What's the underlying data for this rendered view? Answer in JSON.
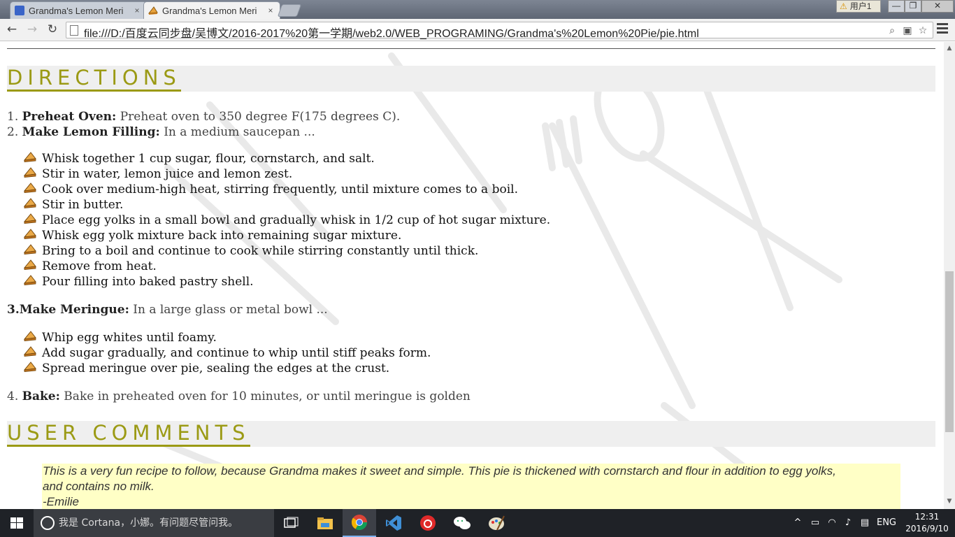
{
  "browser": {
    "tabs": [
      {
        "title": "Grandma's Lemon Meri",
        "close": "×"
      },
      {
        "title": "Grandma's Lemon Meri",
        "close": "×"
      }
    ],
    "user_badge": "用户1",
    "window_buttons": {
      "minimize": "—",
      "restore": "❐",
      "close": "✕"
    },
    "nav": {
      "back": "←",
      "forward": "→",
      "reload": "↻"
    },
    "url": "file:///D:/百度云同步盘/吴博文/2016-2017%20第一学期/web2.0/WEB_PROGRAMING/Grandma's%20Lemon%20Pie/pie.html",
    "omnibox_icons": [
      "zoom-icon",
      "translate-icon",
      "star-icon"
    ]
  },
  "page": {
    "directions_heading": "DIRECTIONS",
    "steps": {
      "s1_num": "1.",
      "s1_label": "Preheat Oven:",
      "s1_text": " Preheat oven to 350 degree F(175 degrees C).",
      "s2_num": "2.",
      "s2_label": "Make Lemon Filling:",
      "s2_text": " In a medium saucepan ...",
      "s3_num": "3.",
      "s3_label": "Make Meringue:",
      "s3_text": " In a large glass or metal bowl ...",
      "s4_num": "4.",
      "s4_label": "Bake:",
      "s4_text": " Bake in preheated oven for 10 minutes, or until meringue is golden"
    },
    "filling_items": [
      "Whisk together 1 cup sugar, flour, cornstarch, and salt.",
      "Stir in water, lemon juice and lemon zest.",
      "Cook over medium-high heat, stirring frequently, until mixture comes to a boil.",
      "Stir in butter.",
      "Place egg yolks in a small bowl and gradually whisk in 1/2 cup of hot sugar mixture.",
      "Whisk egg yolk mixture back into remaining sugar mixture.",
      "Bring to a boil and continue to cook while stirring constantly until thick.",
      "Remove from heat.",
      "Pour filling into baked pastry shell."
    ],
    "meringue_items": [
      "Whip egg whites until foamy.",
      "Add sugar gradually, and continue to whip until stiff peaks form.",
      "Spread meringue over pie, sealing the edges at the crust."
    ],
    "comments_heading": "USER COMMENTS",
    "comment": {
      "line1": "This is a very fun recipe to follow, because Grandma makes it sweet and simple. This pie is thickened with cornstarch and flour in addition to egg yolks,",
      "line2": "and contains no milk.",
      "author": "-Emilie"
    }
  },
  "taskbar": {
    "search_placeholder": "我是 Cortana，小娜。有问题尽管问我。",
    "apps": [
      "task-view-icon",
      "file-explorer-icon",
      "chrome-icon",
      "visual-studio-icon",
      "netease-music-icon",
      "wechat-icon",
      "paint-icon"
    ],
    "tray_up": "^",
    "language": "ENG",
    "time": "12:31",
    "date": "2016/9/10"
  },
  "colors": {
    "heading": "#9b9a14",
    "heading_bg": "#efefef",
    "comment_bg": "#ffffc6",
    "taskbar": "#1f2227"
  }
}
